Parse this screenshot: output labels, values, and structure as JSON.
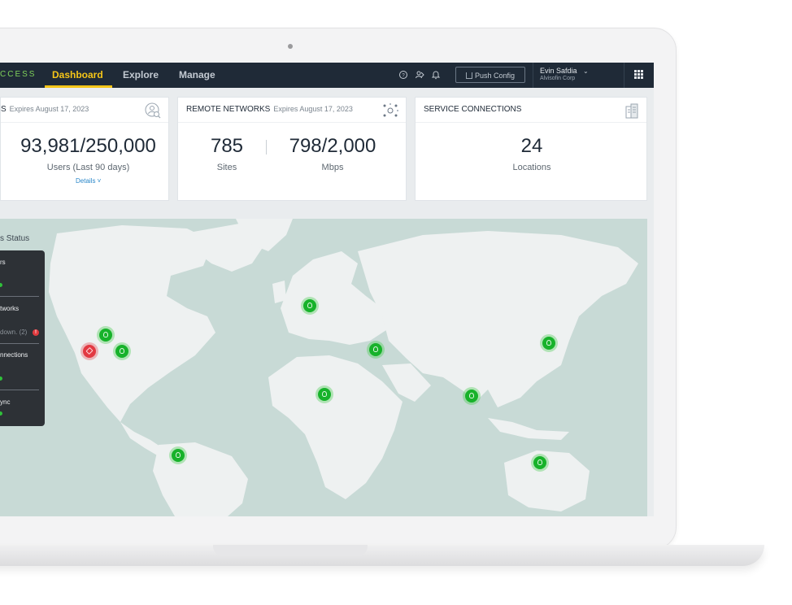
{
  "app": {
    "brand": "CCESS",
    "tabs": [
      "Dashboard",
      "Explore",
      "Manage"
    ],
    "active_tab": "Dashboard"
  },
  "toolbar": {
    "push_config": "Push Config"
  },
  "user": {
    "name": "Evin Safdia",
    "org": "Alvisofin Corp"
  },
  "cards": {
    "users": {
      "title": "S",
      "expires": "Expires August 17, 2023",
      "value": "93,981/250,000",
      "label": "Users (Last 90 days)",
      "details": "Details ˅"
    },
    "remote": {
      "title": "REMOTE NETWORKS",
      "expires": "Expires August 17, 2023",
      "sites_value": "785",
      "sites_label": "Sites",
      "mbps_value": "798/2,000",
      "mbps_label": "Mbps"
    },
    "service": {
      "title": "SERVICE CONNECTIONS",
      "value": "24",
      "label": "Locations"
    }
  },
  "status": {
    "title": "s Status",
    "items": [
      "rs",
      "tworks",
      "nnections",
      "ync"
    ],
    "down_text": "down. (2)",
    "alert_glyph": "!"
  },
  "map": {
    "marker_count": 11,
    "colors": {
      "ok": "#17b22a",
      "down": "#e23942",
      "water": "#c8dad6",
      "land": "#eef1f1"
    }
  }
}
